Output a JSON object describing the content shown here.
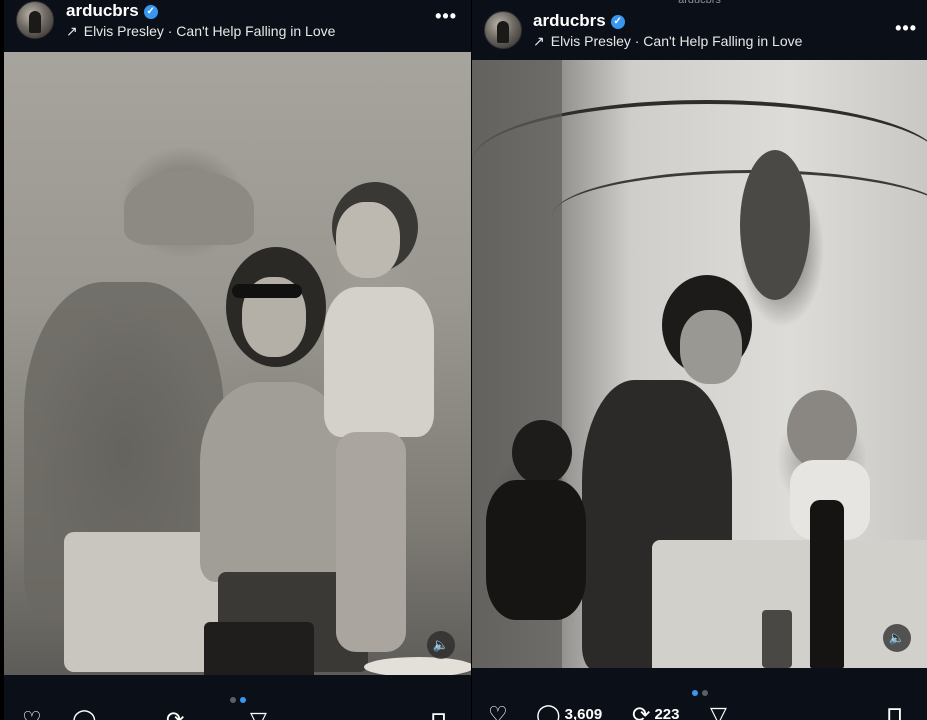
{
  "left_post": {
    "username": "arducbrs",
    "verified_symbol": "✓",
    "music": "Elvis Presley · Can't Help Falling in Love",
    "more_label": "•••",
    "sound_icon": "speaker-icon",
    "carousel_dots": 2,
    "active_dot": 1,
    "actions": {
      "like_icon": "heart-icon",
      "comment_icon": "comment-icon",
      "repost_icon": "repost-icon",
      "share_icon": "send-icon",
      "save_icon": "bookmark-icon"
    }
  },
  "right_post": {
    "top_label": "arducbrs",
    "username": "arducbrs",
    "verified_symbol": "✓",
    "music": "Elvis Presley · Can't Help Falling in Love",
    "more_label": "•••",
    "sound_icon": "speaker-icon",
    "carousel_dots": 2,
    "active_dot": 0,
    "actions": {
      "like_icon": "heart-icon",
      "comment_icon": "comment-icon",
      "comment_count": "3,609",
      "repost_icon": "repost-icon",
      "repost_count": "223",
      "share_icon": "send-icon",
      "save_icon": "bookmark-icon"
    }
  },
  "colors": {
    "background": "#0b0f17",
    "verified_blue": "#3897f0",
    "dot_inactive": "#5a5f68"
  }
}
